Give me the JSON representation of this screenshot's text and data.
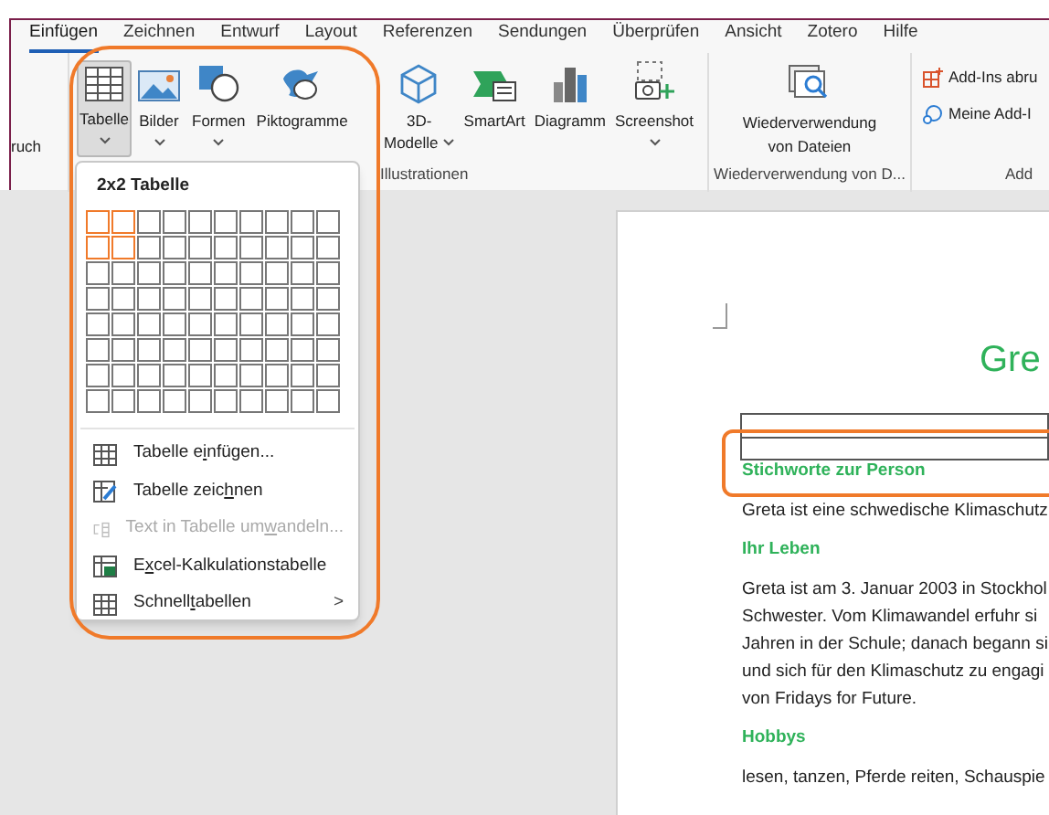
{
  "tabs": [
    {
      "label": "Einfügen",
      "selected": true
    },
    {
      "label": "Zeichnen",
      "selected": false
    },
    {
      "label": "Entwurf",
      "selected": false
    },
    {
      "label": "Layout",
      "selected": false
    },
    {
      "label": "Referenzen",
      "selected": false
    },
    {
      "label": "Sendungen",
      "selected": false
    },
    {
      "label": "Überprüfen",
      "selected": false
    },
    {
      "label": "Ansicht",
      "selected": false
    },
    {
      "label": "Zotero",
      "selected": false
    },
    {
      "label": "Hilfe",
      "selected": false
    }
  ],
  "ribbon": {
    "cut_label": "ruch",
    "table_button": {
      "label": "Tabelle",
      "pressed": true
    },
    "buttons": [
      {
        "kind": "bilder",
        "label": "Bilder",
        "dropdown": true
      },
      {
        "kind": "formen",
        "label": "Formen",
        "dropdown": true
      },
      {
        "kind": "pikto",
        "label": "Piktogramme",
        "dropdown": false
      },
      {
        "kind": "cube",
        "label": "3D-Modelle",
        "dropdown": true
      },
      {
        "kind": "smartart",
        "label": "SmartArt",
        "dropdown": false
      },
      {
        "kind": "chart",
        "label": "Diagramm",
        "dropdown": false
      },
      {
        "kind": "screenshot",
        "label": "Screenshot",
        "dropdown": true
      }
    ],
    "group_illustrations": "Illustrationen",
    "reuse_button": {
      "line1": "Wiederverwendung",
      "line2": "von Dateien"
    },
    "group_reuse": "Wiederverwendung von D...",
    "addins": [
      {
        "kind": "store",
        "label": "Add-Ins abru"
      },
      {
        "kind": "mine",
        "label": "Meine Add-I"
      }
    ],
    "group_addins": "Add"
  },
  "table_menu": {
    "title": "2x2 Tabelle",
    "grid": [
      {
        "cells": [
          {
            "selected": true
          },
          {
            "selected": true
          },
          {
            "selected": false
          },
          {
            "selected": false
          },
          {
            "selected": false
          },
          {
            "selected": false
          },
          {
            "selected": false
          },
          {
            "selected": false
          },
          {
            "selected": false
          },
          {
            "selected": false
          }
        ]
      },
      {
        "cells": [
          {
            "selected": true
          },
          {
            "selected": true
          },
          {
            "selected": false
          },
          {
            "selected": false
          },
          {
            "selected": false
          },
          {
            "selected": false
          },
          {
            "selected": false
          },
          {
            "selected": false
          },
          {
            "selected": false
          },
          {
            "selected": false
          }
        ]
      },
      {
        "cells": [
          {
            "selected": false
          },
          {
            "selected": false
          },
          {
            "selected": false
          },
          {
            "selected": false
          },
          {
            "selected": false
          },
          {
            "selected": false
          },
          {
            "selected": false
          },
          {
            "selected": false
          },
          {
            "selected": false
          },
          {
            "selected": false
          }
        ]
      },
      {
        "cells": [
          {
            "selected": false
          },
          {
            "selected": false
          },
          {
            "selected": false
          },
          {
            "selected": false
          },
          {
            "selected": false
          },
          {
            "selected": false
          },
          {
            "selected": false
          },
          {
            "selected": false
          },
          {
            "selected": false
          },
          {
            "selected": false
          }
        ]
      },
      {
        "cells": [
          {
            "selected": false
          },
          {
            "selected": false
          },
          {
            "selected": false
          },
          {
            "selected": false
          },
          {
            "selected": false
          },
          {
            "selected": false
          },
          {
            "selected": false
          },
          {
            "selected": false
          },
          {
            "selected": false
          },
          {
            "selected": false
          }
        ]
      },
      {
        "cells": [
          {
            "selected": false
          },
          {
            "selected": false
          },
          {
            "selected": false
          },
          {
            "selected": false
          },
          {
            "selected": false
          },
          {
            "selected": false
          },
          {
            "selected": false
          },
          {
            "selected": false
          },
          {
            "selected": false
          },
          {
            "selected": false
          }
        ]
      },
      {
        "cells": [
          {
            "selected": false
          },
          {
            "selected": false
          },
          {
            "selected": false
          },
          {
            "selected": false
          },
          {
            "selected": false
          },
          {
            "selected": false
          },
          {
            "selected": false
          },
          {
            "selected": false
          },
          {
            "selected": false
          },
          {
            "selected": false
          }
        ]
      },
      {
        "cells": [
          {
            "selected": false
          },
          {
            "selected": false
          },
          {
            "selected": false
          },
          {
            "selected": false
          },
          {
            "selected": false
          },
          {
            "selected": false
          },
          {
            "selected": false
          },
          {
            "selected": false
          },
          {
            "selected": false
          },
          {
            "selected": false
          }
        ]
      }
    ],
    "items": [
      {
        "kind": "insert",
        "parts": [
          "Tabelle e",
          "i",
          "nfügen..."
        ],
        "disabled": false
      },
      {
        "kind": "draw",
        "parts": [
          "Tabelle zeic",
          "h",
          "nen"
        ],
        "disabled": false
      },
      {
        "kind": "convert",
        "parts": [
          "Text in Tabelle um",
          "w",
          "andeln..."
        ],
        "disabled": true
      },
      {
        "kind": "excel",
        "parts": [
          "E",
          "x",
          "cel-Kalkulationstabelle"
        ],
        "disabled": false
      },
      {
        "kind": "quick",
        "parts": [
          "Schnell",
          "t",
          "abellen"
        ],
        "disabled": false,
        "arrow": ">"
      }
    ]
  },
  "document": {
    "title": "Gre",
    "blocks": [
      {
        "kind": "heading",
        "text": "Stichworte zur Person"
      },
      {
        "kind": "para",
        "lines": [
          "Greta ist eine schwedische Klimaschutz"
        ]
      },
      {
        "kind": "heading",
        "text": "Ihr Leben"
      },
      {
        "kind": "para",
        "lines": [
          "Greta ist am 3. Januar 2003 in Stockhol",
          "Schwester. Vom Klimawandel erfuhr si",
          "Jahren in der Schule; danach begann si",
          "und sich für den Klimaschutz zu engagi",
          "von Fridays for Future."
        ]
      },
      {
        "kind": "heading",
        "text": "Hobbys"
      },
      {
        "kind": "para",
        "lines": [
          "lesen, tanzen, Pferde reiten, Schauspie"
        ]
      }
    ]
  }
}
